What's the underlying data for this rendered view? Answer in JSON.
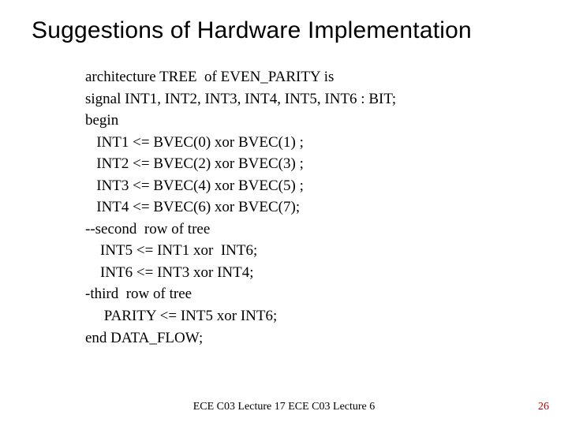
{
  "title": "Suggestions of Hardware Implementation",
  "code": {
    "l1": "architecture TREE  of EVEN_PARITY is",
    "l2": "signal INT1, INT2, INT3, INT4, INT5, INT6 : BIT;",
    "l3": "begin",
    "l4": "   INT1 <= BVEC(0) xor BVEC(1) ;",
    "l5": "   INT2 <= BVEC(2) xor BVEC(3) ;",
    "l6": "   INT3 <= BVEC(4) xor BVEC(5) ;",
    "l7": "   INT4 <= BVEC(6) xor BVEC(7);",
    "l8": "--second  row of tree",
    "l9": "    INT5 <= INT1 xor  INT6;",
    "l10": "    INT6 <= INT3 xor INT4;",
    "l11": "-third  row of tree",
    "l12": "     PARITY <= INT5 xor INT6;",
    "l13": "end DATA_FLOW;"
  },
  "footer": "ECE C03 Lecture 17 ECE C03 Lecture 6",
  "page_number": "26"
}
